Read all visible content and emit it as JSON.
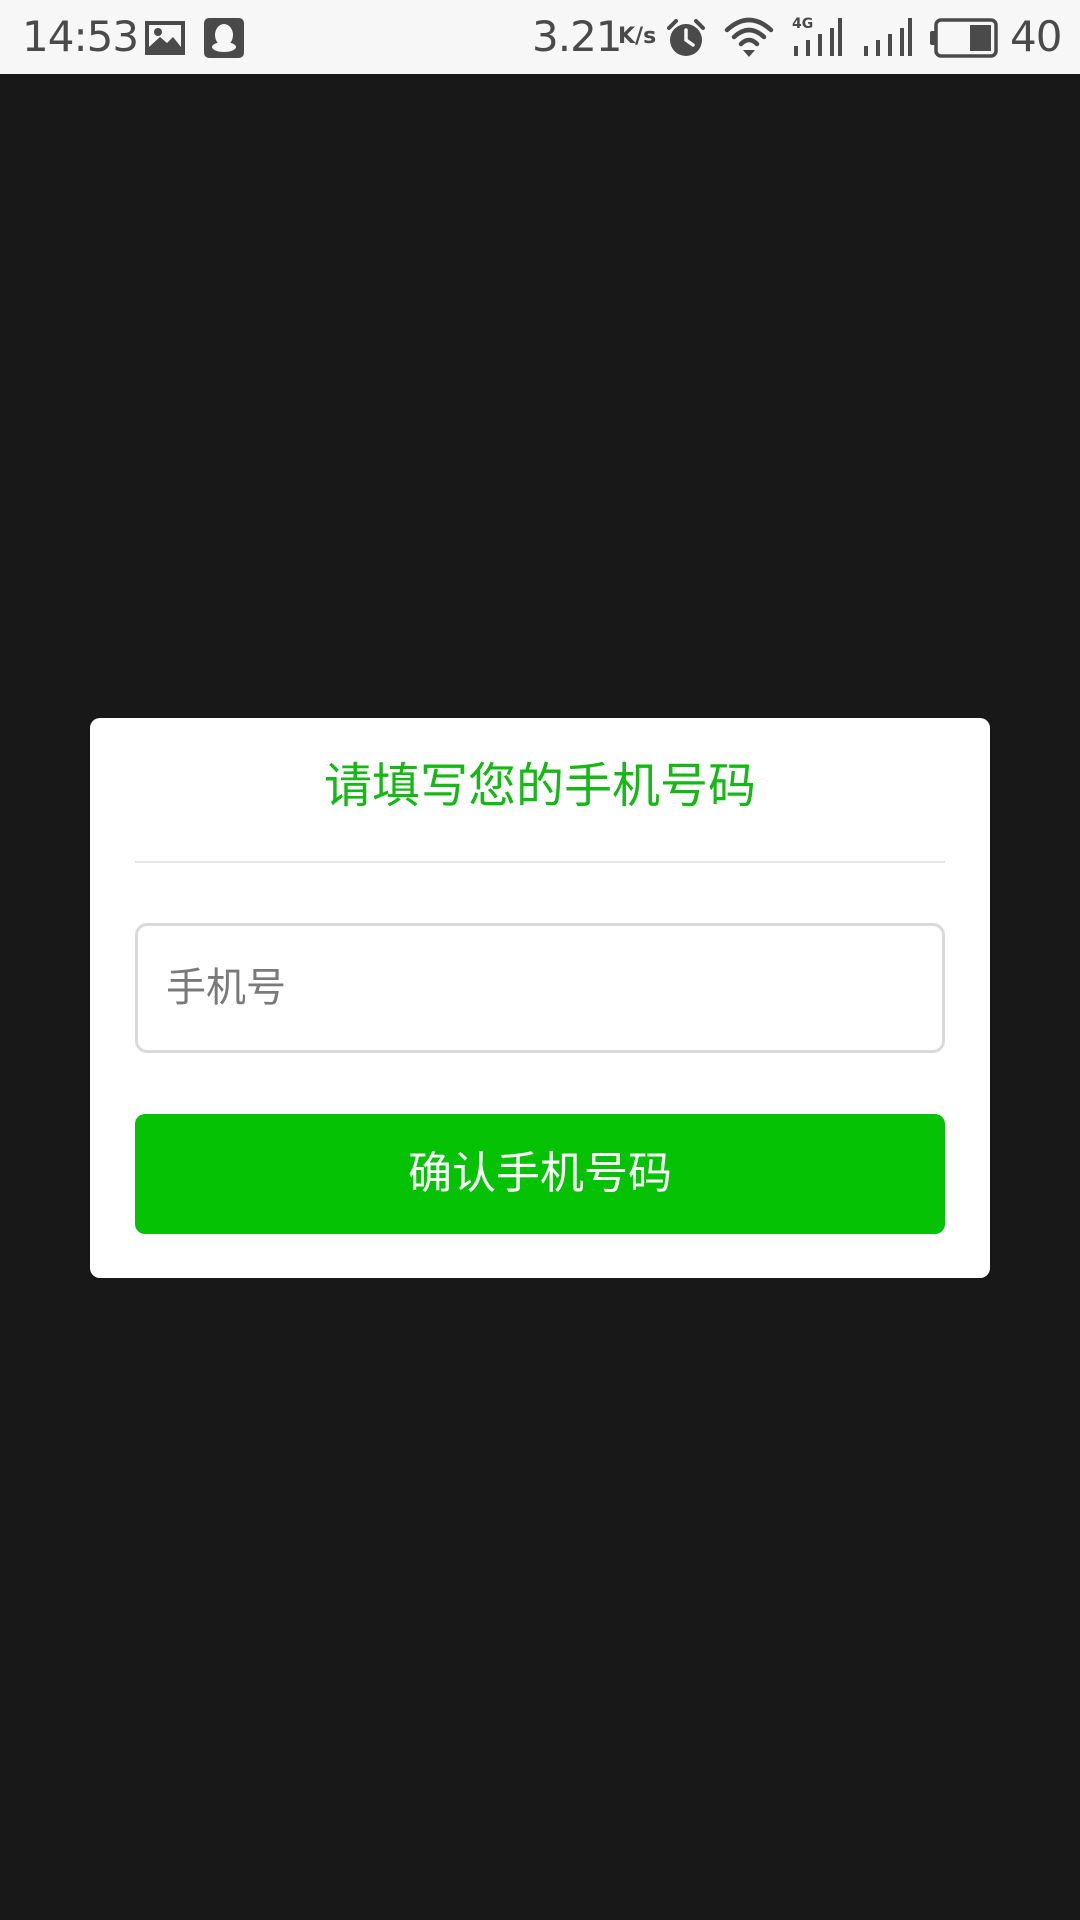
{
  "status_bar": {
    "time": "14:53",
    "network_speed": "3.21",
    "network_speed_unit": "K/s",
    "battery_level": "40",
    "icons": [
      "image-icon",
      "qq-icon",
      "alarm-icon",
      "wifi-icon",
      "signal-4g-icon",
      "signal-icon",
      "battery-icon"
    ]
  },
  "dialog": {
    "title": "请填写您的手机号码",
    "phone_input": {
      "placeholder": "手机号",
      "value": ""
    },
    "confirm_label": "确认手机号码"
  },
  "colors": {
    "accent_green": "#05c205",
    "title_green": "#16b816",
    "overlay": "#181818"
  }
}
